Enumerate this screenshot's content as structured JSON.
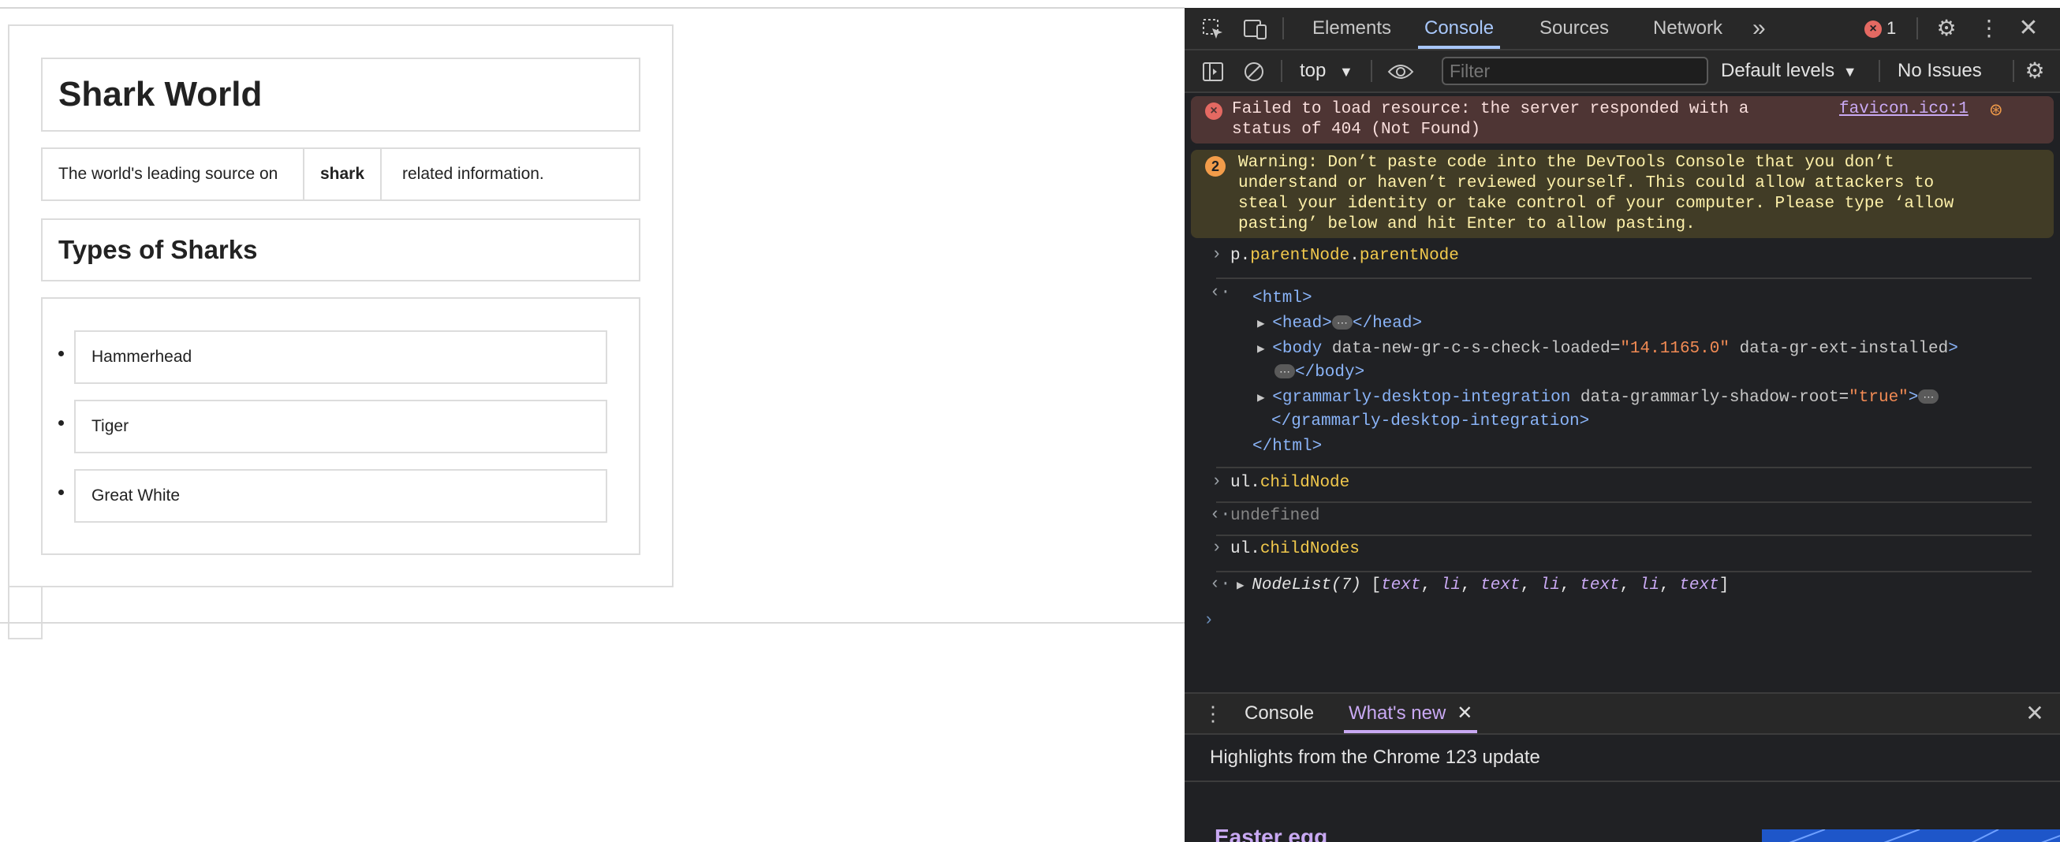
{
  "page": {
    "title": "Shark World",
    "tagline_before": "The world's leading source on",
    "tagline_bold": "shark",
    "tagline_after": "related information.",
    "section_title": "Types of Sharks",
    "sharks": [
      "Hammerhead",
      "Tiger",
      "Great White"
    ]
  },
  "devtools": {
    "tabs": [
      "Elements",
      "Console",
      "Sources",
      "Network"
    ],
    "active_tab": "Console",
    "more_tabs_glyph": "»",
    "error_count": "1",
    "toolbar": {
      "context": "top",
      "filter_placeholder": "Filter",
      "levels": "Default levels",
      "issues": "No Issues"
    },
    "console": {
      "error_text_line1": "Failed to load resource: the server responded with a",
      "error_text_line2": "status of 404 (Not Found)",
      "error_source": "favicon.ico:1",
      "warning_count": "2",
      "warning_lines": [
        "Warning: Don’t paste code into the DevTools Console that you don’t",
        "understand or haven’t reviewed yourself. This could allow attackers to",
        "steal your identity or take control of your computer. Please type ‘allow",
        "pasting’ below and hit Enter to allow pasting."
      ],
      "cmd1_obj": "p",
      "cmd1_prop1": "parentNode",
      "cmd1_prop2": "parentNode",
      "html_open": "<html>",
      "head_open": "<head>",
      "head_close": "</head>",
      "body_open": "<body",
      "body_attr1_name": "data-new-gr-c-s-check-loaded",
      "body_attr1_val": "\"14.1165.0\"",
      "body_attr2_name": "data-gr-ext-installed",
      "body_close": "</body>",
      "gram_open": "<grammarly-desktop-integration",
      "gram_attr_name": "data-grammarly-shadow-root",
      "gram_attr_val": "\"true\"",
      "gram_close": "</grammarly-desktop-integration>",
      "html_close": "</html>",
      "cmd2_obj": "ul",
      "cmd2_prop": "childNode",
      "result2": "undefined",
      "cmd3_obj": "ul",
      "cmd3_prop": "childNodes",
      "nodelist_label": "NodeList(7)",
      "nodelist_items": [
        "text",
        "li",
        "text",
        "li",
        "text",
        "li",
        "text"
      ]
    },
    "drawer": {
      "tabs": [
        "Console",
        "What's new"
      ],
      "active_tab": "What's new",
      "highlights": "Highlights from the Chrome 123 update",
      "easter_egg": "Easter egg"
    }
  }
}
